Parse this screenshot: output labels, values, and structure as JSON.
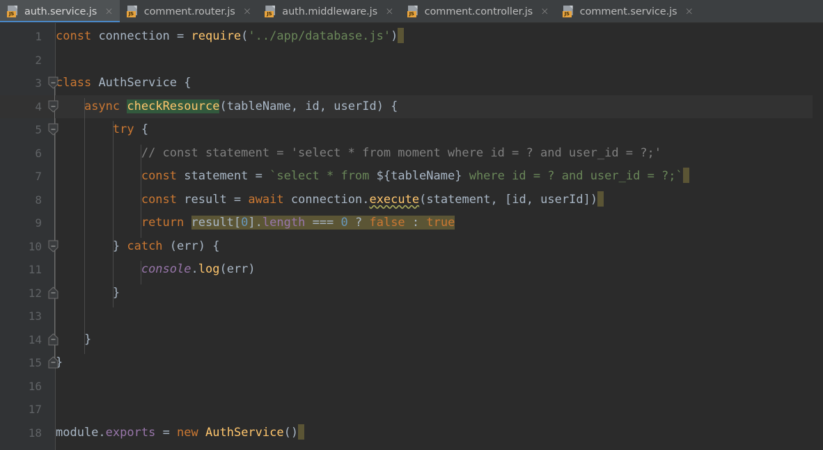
{
  "window": {
    "app": "code-editor",
    "theme": "darcula"
  },
  "colors": {
    "tabbar_bg": "#3c3f41",
    "active_tab_bg": "#4e5254",
    "active_tab_underline": "#4a88c7",
    "editor_bg": "#2b2b2b",
    "gutter_bg": "#313335",
    "caret_row_bg": "#323232",
    "selection_hl": "#5b5535",
    "usage_hl": "#32593d",
    "keyword": "#cc7832",
    "string": "#6a8759",
    "comment": "#808080",
    "number": "#6897bb",
    "function": "#ffc66d",
    "field": "#9876aa",
    "default_text": "#a9b7c6",
    "linenum": "#606366"
  },
  "tabs": [
    {
      "label": "auth.service.js",
      "icon": "js-file-icon",
      "badge": "JS",
      "active": true,
      "close": "×"
    },
    {
      "label": "comment.router.js",
      "icon": "js-file-icon",
      "badge": "JS",
      "active": false,
      "close": "×"
    },
    {
      "label": "auth.middleware.js",
      "icon": "js-file-icon",
      "badge": "JS",
      "active": false,
      "close": "×"
    },
    {
      "label": "comment.controller.js",
      "icon": "js-file-icon",
      "badge": "JS",
      "active": false,
      "close": "×"
    },
    {
      "label": "comment.service.js",
      "icon": "js-file-icon",
      "badge": "JS",
      "active": false,
      "close": "×"
    }
  ],
  "editor": {
    "filename": "auth.service.js",
    "language": "javascript",
    "first_line": 1,
    "last_line": 18,
    "line_numbers": [
      "1",
      "2",
      "3",
      "4",
      "5",
      "6",
      "7",
      "8",
      "9",
      "10",
      "11",
      "12",
      "13",
      "14",
      "15",
      "16",
      "17",
      "18"
    ],
    "caret_line": 4,
    "lines": [
      {
        "n": "1",
        "text": "const connection = require('../app/database.js')"
      },
      {
        "n": "2",
        "text": ""
      },
      {
        "n": "3",
        "text": "class AuthService {"
      },
      {
        "n": "4",
        "text": "    async checkResource(tableName, id, userId) {"
      },
      {
        "n": "5",
        "text": "        try {"
      },
      {
        "n": "6",
        "text": "            // const statement = 'select * from moment where id = ? and user_id = ?;'"
      },
      {
        "n": "7",
        "text": "            const statement = `select * from ${tableName} where id = ? and user_id = ?;`"
      },
      {
        "n": "8",
        "text": "            const result = await connection.execute(statement, [id, userId])"
      },
      {
        "n": "9",
        "text": "            return result[0].length === 0 ? false : true"
      },
      {
        "n": "10",
        "text": "        } catch (err) {"
      },
      {
        "n": "11",
        "text": "            console.log(err)"
      },
      {
        "n": "12",
        "text": "        }"
      },
      {
        "n": "13",
        "text": ""
      },
      {
        "n": "14",
        "text": "    }"
      },
      {
        "n": "15",
        "text": "}"
      },
      {
        "n": "16",
        "text": ""
      },
      {
        "n": "17",
        "text": ""
      },
      {
        "n": "18",
        "text": "module.exports = new AuthService()"
      }
    ],
    "selection": {
      "line": 9,
      "text": "result[0].length === 0 ? false : true"
    },
    "usage_highlight": {
      "line": 4,
      "text": "checkResource"
    },
    "warning": {
      "line": 8,
      "token": "execute",
      "style": "wavy-underline"
    },
    "fold_markers": [
      {
        "line": 3,
        "type": "expanded-open"
      },
      {
        "line": 4,
        "type": "expanded-open"
      },
      {
        "line": 5,
        "type": "expanded-open"
      },
      {
        "line": 10,
        "type": "expanded-open"
      },
      {
        "line": 12,
        "type": "expanded-close"
      },
      {
        "line": 14,
        "type": "expanded-close"
      },
      {
        "line": 15,
        "type": "expanded-close"
      }
    ]
  }
}
